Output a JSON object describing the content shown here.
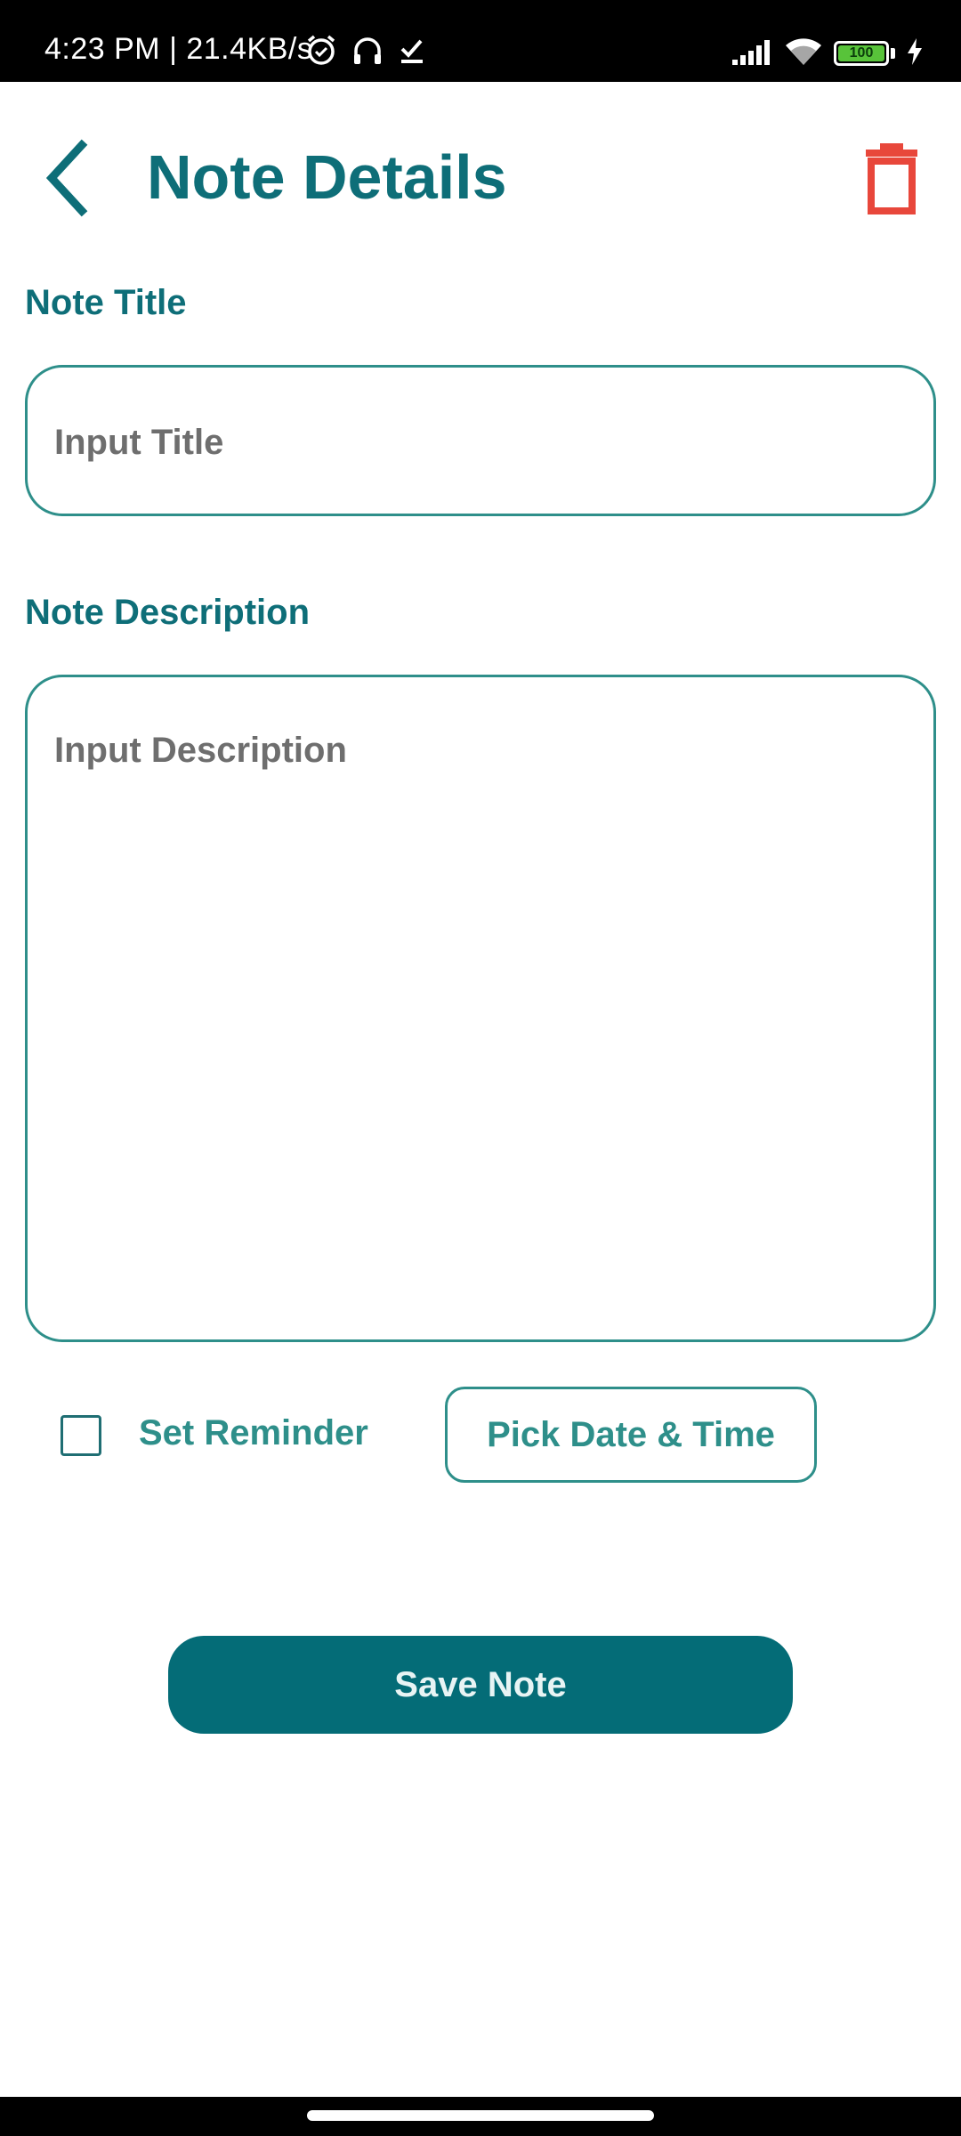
{
  "status_bar": {
    "time": "4:23 PM | 21.4KB/s",
    "battery_level": "100",
    "icons_left": [
      "alarm-icon",
      "headset-icon",
      "download-done-icon"
    ],
    "icons_right": [
      "signal-icon",
      "wifi-icon",
      "battery-icon",
      "charging-icon"
    ]
  },
  "header": {
    "title": "Note Details",
    "back_icon": "chevron-left-icon",
    "delete_icon": "trash-icon"
  },
  "form": {
    "title_label": "Note Title",
    "title_placeholder": "Input Title",
    "title_value": "",
    "description_label": "Note Description",
    "description_placeholder": "Input Description",
    "description_value": ""
  },
  "reminder": {
    "label": "Set Reminder",
    "checked": false,
    "pick_button_label": "Pick Date & Time"
  },
  "actions": {
    "save_label": "Save Note"
  },
  "colors": {
    "primary": "#0e6e78",
    "accent": "#2e8f8a",
    "button": "#046c77",
    "delete": "#e8473b",
    "placeholder": "#6e6e6e"
  }
}
